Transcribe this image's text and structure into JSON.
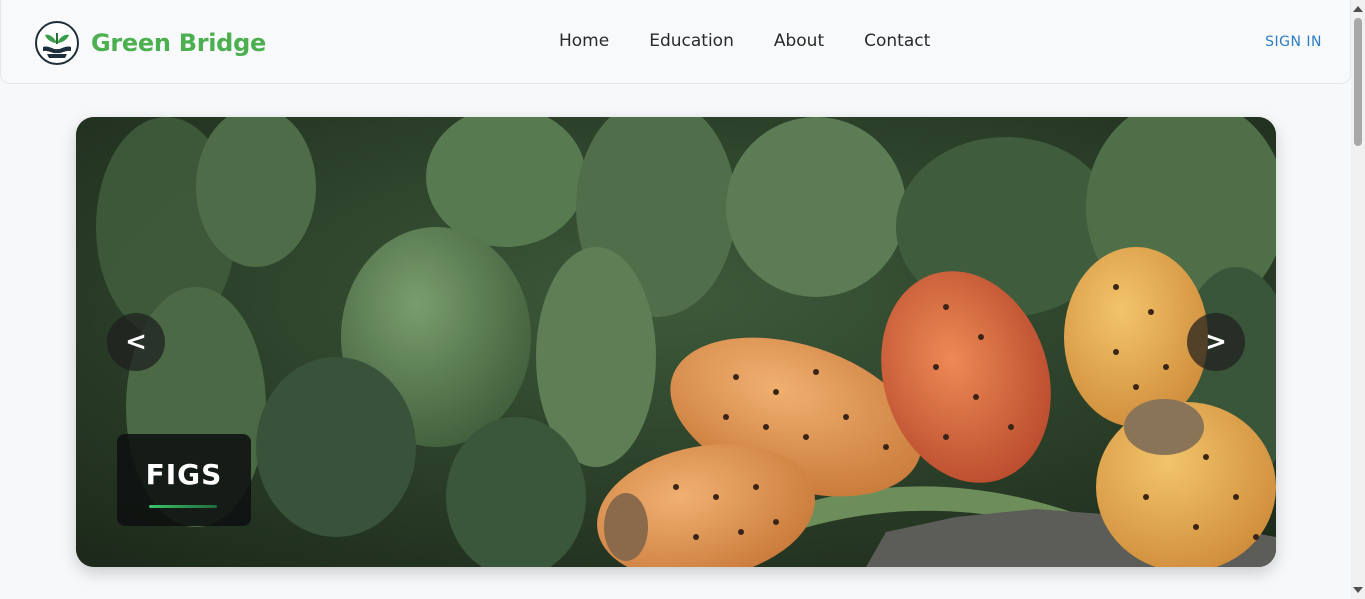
{
  "header": {
    "brand_name": "Green Bridge",
    "logo_icon": "plant-handshake-logo-icon",
    "nav": [
      {
        "label": "Home"
      },
      {
        "label": "Education"
      },
      {
        "label": "About"
      },
      {
        "label": "Contact"
      }
    ],
    "signin_label": "SIGN IN"
  },
  "hero": {
    "prev_label": "<",
    "next_label": ">",
    "caption": "FIGS",
    "image_subject": "prickly-pear-fruit-photo"
  },
  "colors": {
    "brand_green": "#4caf50",
    "signin_blue": "#2e7dc2",
    "background": "#f6f8fa"
  }
}
